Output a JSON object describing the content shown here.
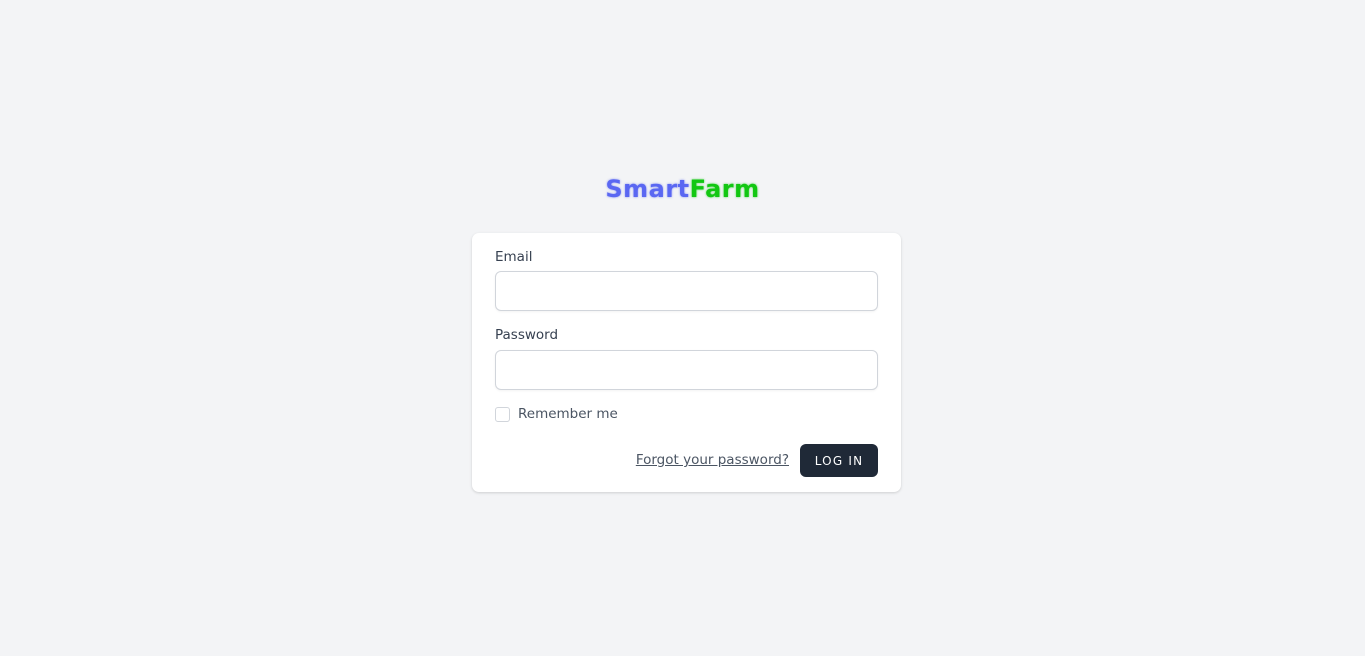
{
  "logo": {
    "part1": "Smart",
    "part2": "Farm",
    "color1": "#5a67f2",
    "color2": "#12c712"
  },
  "form": {
    "email_label": "Email",
    "email_value": "",
    "password_label": "Password",
    "password_value": "",
    "remember_label": "Remember me",
    "remember_checked": false,
    "forgot_label": "Forgot your password?",
    "submit_label": "LOG IN"
  },
  "colors": {
    "background": "#f3f4f6",
    "button": "#1f2937"
  }
}
